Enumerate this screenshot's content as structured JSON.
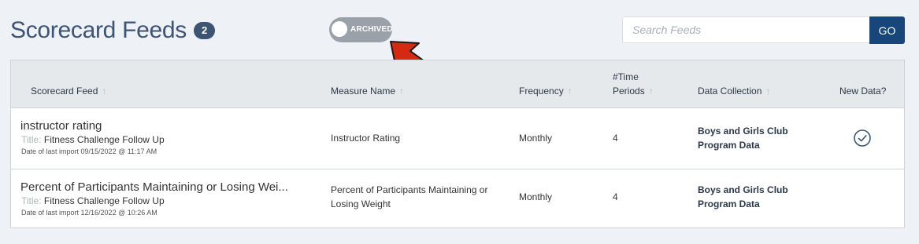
{
  "header": {
    "title": "Scorecard Feeds",
    "count": "2",
    "archived_toggle_label": "ARCHIVED",
    "archived_toggle_on": false
  },
  "search": {
    "placeholder": "Search Feeds",
    "value": "",
    "go_label": "GO"
  },
  "table": {
    "columns": [
      {
        "label": "Scorecard Feed",
        "sortable": true
      },
      {
        "label": "Measure Name",
        "sortable": true
      },
      {
        "label": "Frequency",
        "sortable": true
      },
      {
        "label_line1": "#Time",
        "label_line2": "Periods",
        "sortable": true
      },
      {
        "label": "Data Collection",
        "sortable": true
      },
      {
        "label": "New Data?",
        "sortable": false
      }
    ],
    "rows": [
      {
        "feed_name": "instructor rating",
        "title_prefix": "Title:",
        "title_value": "Fitness Challenge Follow Up",
        "import_date": "Date of last import 09/15/2022 @ 11:17 AM",
        "measure_line1": "Instructor Rating",
        "measure_line2": "",
        "frequency": "Monthly",
        "time_periods": "4",
        "data_collection_line1": "Boys and Girls Club",
        "data_collection_line2": "Program Data",
        "new_data": true
      },
      {
        "feed_name": "Percent of Participants Maintaining or Losing Wei...",
        "title_prefix": "Title:",
        "title_value": "Fitness Challenge Follow Up",
        "import_date": "Date of last import 12/16/2022 @ 10:26 AM",
        "measure_line1": "Percent of Participants Maintaining or",
        "measure_line2": "Losing Weight",
        "frequency": "Monthly",
        "time_periods": "4",
        "data_collection_line1": "Boys and Girls Club",
        "data_collection_line2": "Program Data",
        "new_data": false
      }
    ]
  },
  "colors": {
    "title": "#3d5473",
    "go_button": "#17467a",
    "toggle_off": "#9aa1a8",
    "annotation_arrow": "#d42a12"
  }
}
